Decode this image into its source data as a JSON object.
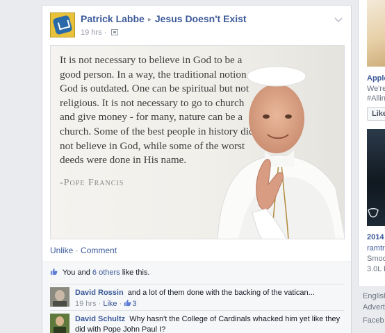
{
  "post": {
    "author": "Patrick Labbe",
    "separator": "▸",
    "group": "Jesus Doesn't Exist",
    "time": "19 hrs",
    "quote": {
      "text": "It is not necessary to believe in God to be a good person. In a way, the traditional notion of God is outdated. One can be spiritual but not religious. It is not necessary to go to church and give money - for many, nature can be a church. Some of the best people in history did not believe in God, while some of the worst deeds were done in His name.",
      "author": "-Pope Francis"
    },
    "actions": {
      "unlike": "Unlike",
      "dot": "·",
      "comment": "Comment"
    },
    "likes": {
      "prefix": "You and",
      "others": "6 others",
      "suffix": "like this."
    },
    "comments": [
      {
        "author": "David Rossin",
        "text": "and a lot of them done with the backing of the vatican...",
        "time": "19 hrs",
        "like": "Like",
        "like_count": "3"
      },
      {
        "author": "David Schultz",
        "text": "Why hasn't the College of Cardinals whacked him yet like they did with Pope John Paul I?"
      }
    ]
  },
  "sidebar": {
    "ad1": {
      "title": "Apple",
      "line1": "We're",
      "line2": "#Allin",
      "like": "Like"
    },
    "ad2": {
      "title": "2014",
      "line1": "ramtr",
      "line2": "Smoo",
      "line3": "3.0L E"
    },
    "footer": {
      "lang": "English",
      "advert": "Advert",
      "facebook": "Faceb"
    }
  },
  "colors": {
    "link": "#3b5998",
    "muted": "#9197a3",
    "background": "#e9ebee"
  }
}
